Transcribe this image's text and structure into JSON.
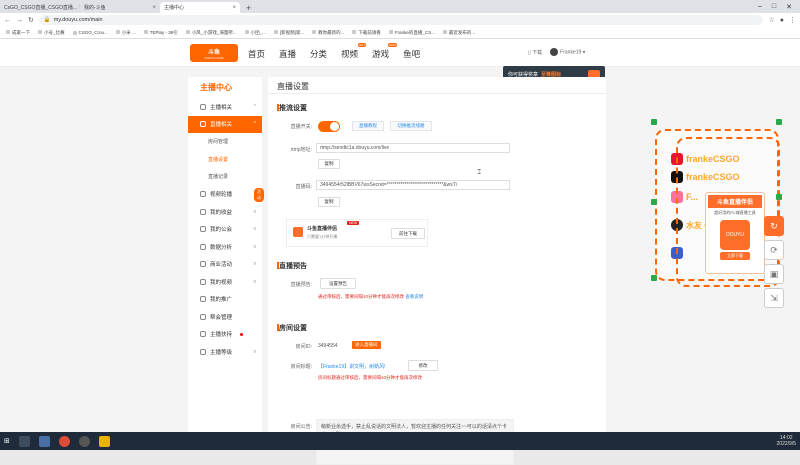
{
  "browser": {
    "tabs": [
      {
        "label": "CsGO_CSGO直播_CSGO直播..."
      },
      {
        "label": "我的-斗鱼"
      },
      {
        "label": "主播中心"
      }
    ],
    "url": "my.douyu.com/main",
    "bookmarks": [
      "成家一下",
      "小号_比赛",
      "CSGO_Crou...",
      "小米 ...",
      "TEPlay - 38引",
      "小风_小游戏_海量所...",
      "小团_...",
      "[新视频]第...",
      "教你最新的...",
      "下载前请看",
      "Franke的直播_CS...",
      "最近发布的..."
    ]
  },
  "nav": {
    "logo_main": "斗鱼",
    "logo_sub": "DOUYU.COM",
    "items": [
      "首页",
      "直播",
      "分类",
      "视频",
      "游戏",
      "鱼吧"
    ],
    "video_badge": "HOT",
    "game_badge": "NEW",
    "download": "下载",
    "username": "Franke19",
    "tip_text": "你可获得奖章",
    "tip_highlight": "至尊图标"
  },
  "sidebar": {
    "title": "主播中心",
    "items": [
      {
        "label": "主播相关",
        "type": "group"
      },
      {
        "label": "直播相关",
        "type": "group-active"
      },
      {
        "label": "房间管理",
        "type": "sub"
      },
      {
        "label": "直播设置",
        "type": "sub-selected"
      },
      {
        "label": "直播记录",
        "type": "sub"
      },
      {
        "label": "视频轮播",
        "type": "group"
      },
      {
        "label": "我的收益",
        "type": "group"
      },
      {
        "label": "我的公会",
        "type": "group"
      },
      {
        "label": "数据分析",
        "type": "group"
      },
      {
        "label": "商业活动",
        "type": "group"
      },
      {
        "label": "我的视频",
        "type": "group"
      },
      {
        "label": "我的推广",
        "type": "group"
      },
      {
        "label": "帮会管理",
        "type": "group"
      },
      {
        "label": "主播扶持",
        "type": "group"
      },
      {
        "label": "主播等级",
        "type": "group"
      }
    ],
    "new_badge": "活动"
  },
  "main": {
    "title": "直播设置",
    "stream": {
      "section": "推流设置",
      "switch_label": "直播开关:",
      "switch_on": true,
      "btn_1": "直播教程",
      "btn_2": "切换推流线路",
      "rtmp_label": "rtmp地址:",
      "rtmp_value": "rtmp://sendtc1a.douyu.com/live",
      "copy": "复制",
      "code_label": "直播码:",
      "code_value": "3494554r52lBBV67wsSecret=*****************************&wsTi",
      "copy2": "复制",
      "companion_title": "斗鱼直播伴侣",
      "companion_new": "NEW",
      "companion_sub": "只需要1分钟开播",
      "companion_btn": "前往下载"
    },
    "preview": {
      "section": "直播预告",
      "label": "直播预告:",
      "btn": "设置预告",
      "note": "通过审核后，需要间隔10分钟才能再次修改",
      "link": "查看说明"
    },
    "room": {
      "section": "房间设置",
      "id_label": "房间ID:",
      "id_value": "3494554",
      "enter_btn": "进入直播间",
      "name_label": "房间标题:",
      "name_value": "【Franke19】讲文明，树新风!",
      "edit_btn": "修改",
      "name_note": "房间标题通过审核后，需要间隔10分钟才能再次修改",
      "notice_label": "房间公告:",
      "notice_text": "萌新业余选手，禁止乱说话的文明法人，暂欢迎主播的任何关注~~可以的话请点个卡嘛~~Q群915035753"
    }
  },
  "overlay": {
    "weibo": "frankeCSGO",
    "tiktok": "frankeCSGO",
    "bili": "F...",
    "qq_prefix": "水友 Q",
    "qq": "915035753",
    "promo_head": "斗鱼直播伴侣",
    "promo_sub": "超好用的PC端直播工具",
    "promo_logo": "DOUYU",
    "promo_dl": "立即下载",
    "accent": "#ff6600"
  },
  "taskbar": {
    "time": "14:02",
    "date": "2022/9/5"
  }
}
